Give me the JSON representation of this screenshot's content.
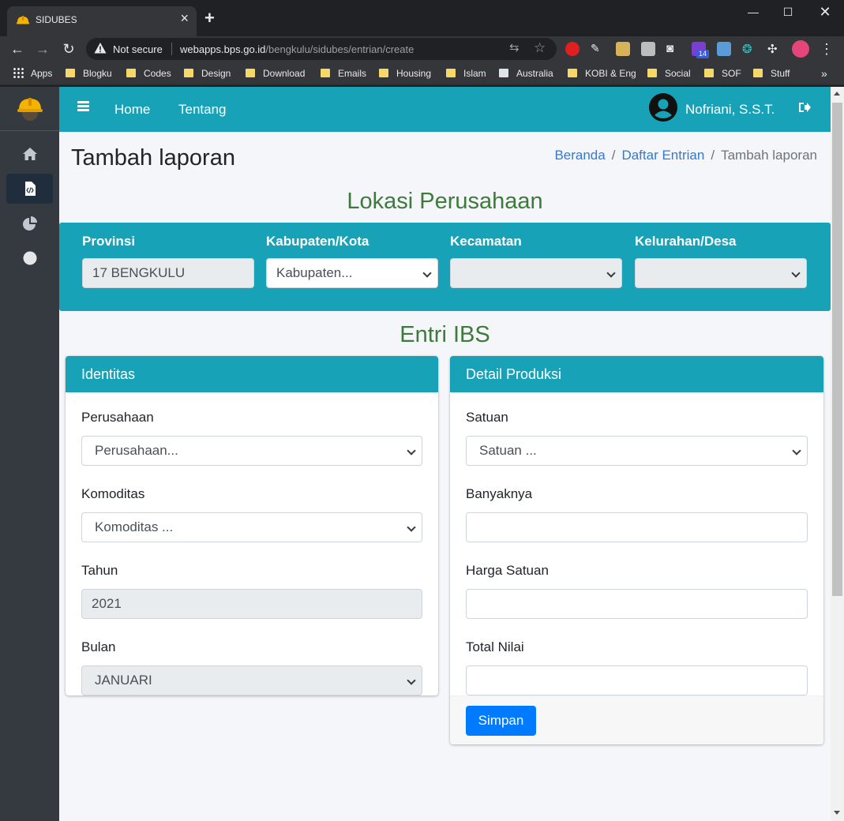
{
  "browser": {
    "tab_title": "SIDUBES",
    "new_tab_symbol": "+",
    "security_label": "Not secure",
    "url_host": "webapps.bps.go.id",
    "url_path": "/bengkulu/sidubes/entrian/create",
    "extension_badge": "14",
    "bookmarks": [
      "Apps",
      "Blogku",
      "Codes",
      "Design",
      "Download",
      "Emails",
      "Housing",
      "Islam",
      "Australia",
      "KOBI & Eng",
      "Social",
      "SOF",
      "Stuff"
    ],
    "bookmarks_overflow": "»"
  },
  "nav": {
    "home": "Home",
    "about": "Tentang",
    "user_name": "Nofriani, S.S.T."
  },
  "sidebar": {
    "icons": [
      "home-icon",
      "file-code-icon",
      "chart-pie-icon",
      "circle-icon"
    ],
    "active_index": 1
  },
  "page": {
    "title": "Tambah laporan",
    "breadcrumb": [
      "Beranda",
      "Daftar Entrian",
      "Tambah laporan"
    ]
  },
  "lokasi": {
    "heading": "Lokasi Perusahaan",
    "provinsi_label": "Provinsi",
    "provinsi_value": "17 BENGKULU",
    "kabupaten_label": "Kabupaten/Kota",
    "kabupaten_value": "Kabupaten...",
    "kecamatan_label": "Kecamatan",
    "kecamatan_value": "",
    "kelurahan_label": "Kelurahan/Desa",
    "kelurahan_value": ""
  },
  "entri": {
    "heading": "Entri IBS",
    "identitas": {
      "header": "Identitas",
      "perusahaan_label": "Perusahaan",
      "perusahaan_value": "Perusahaan...",
      "komoditas_label": "Komoditas",
      "komoditas_value": "Komoditas ...",
      "tahun_label": "Tahun",
      "tahun_value": "2021",
      "bulan_label": "Bulan",
      "bulan_value": "JANUARI"
    },
    "produksi": {
      "header": "Detail Produksi",
      "satuan_label": "Satuan",
      "satuan_value": "Satuan ...",
      "banyaknya_label": "Banyaknya",
      "banyaknya_value": "",
      "harga_label": "Harga Satuan",
      "harga_value": "",
      "total_label": "Total Nilai",
      "total_value": "",
      "submit_label": "Simpan"
    }
  },
  "colors": {
    "accent": "#17a2b8",
    "sidebar": "#343a40",
    "heading_green": "#3e7a3c",
    "primary_button": "#007bff",
    "link": "#2f7bd6"
  }
}
